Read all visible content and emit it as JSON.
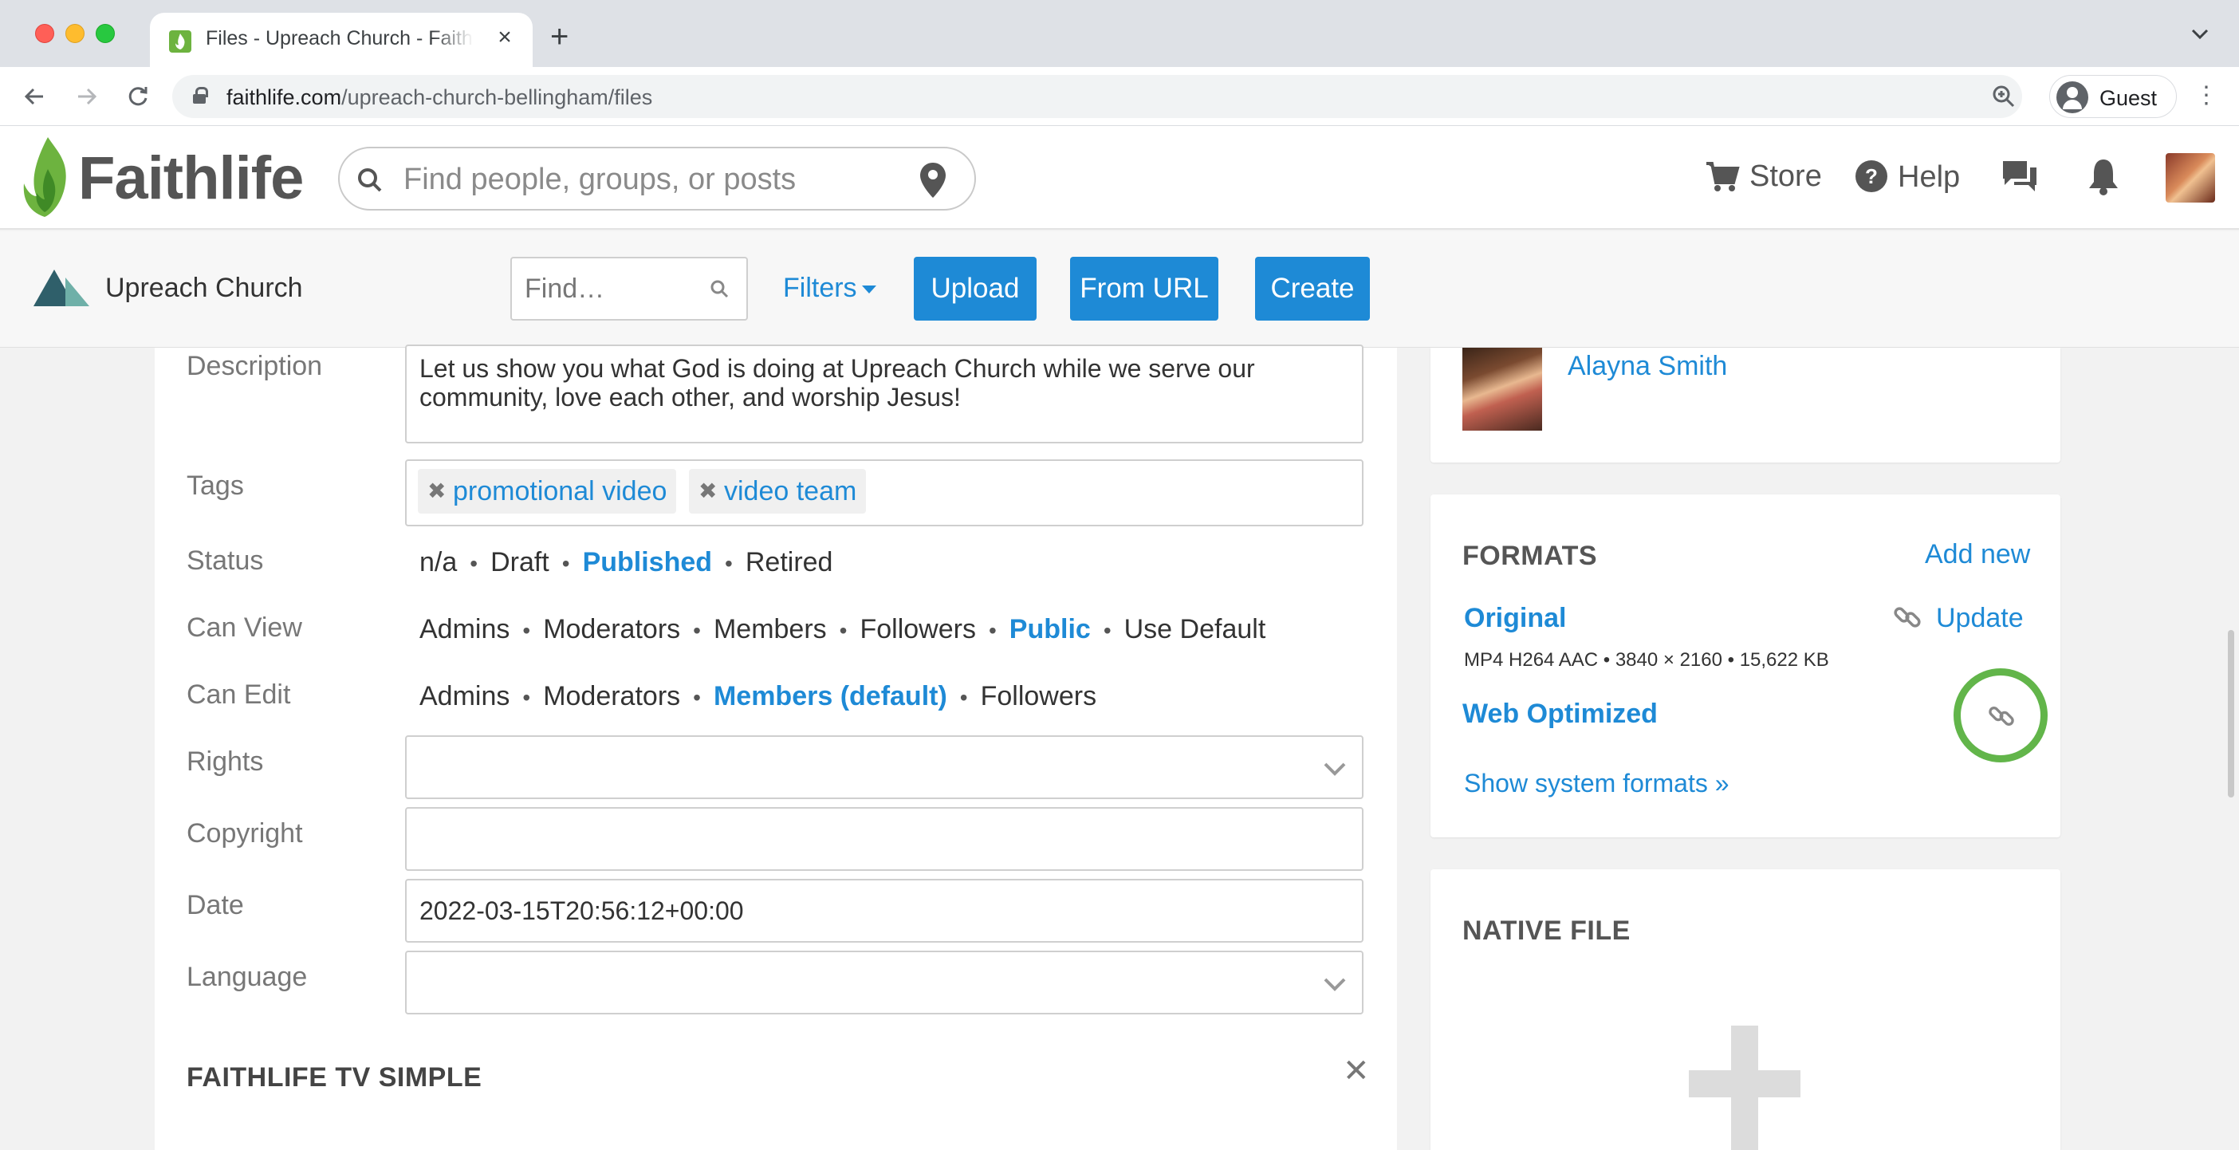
{
  "browser": {
    "tab_title": "Files - Upreach Church - Faithlife",
    "url_domain": "faithlife.com",
    "url_path": "/upreach-church-bellingham/files",
    "profile_label": "Guest"
  },
  "header": {
    "logo_text": "Faithlife",
    "search_placeholder": "Find people, groups, or posts",
    "store_label": "Store",
    "help_label": "Help"
  },
  "group_bar": {
    "group_name": "Upreach Church",
    "find_placeholder": "Find…",
    "filters_label": "Filters",
    "upload_label": "Upload",
    "from_url_label": "From URL",
    "create_label": "Create"
  },
  "form": {
    "description_label": "Description",
    "description_value": "Let us show you what God is doing at Upreach Church while we serve our community, love each other, and worship Jesus!",
    "tags_label": "Tags",
    "tags": [
      "promotional video",
      "video team"
    ],
    "status_label": "Status",
    "status_options": [
      "n/a",
      "Draft",
      "Published",
      "Retired"
    ],
    "status_selected": "Published",
    "can_view_label": "Can View",
    "can_view_options": [
      "Admins",
      "Moderators",
      "Members",
      "Followers",
      "Public",
      "Use Default"
    ],
    "can_view_selected": "Public",
    "can_edit_label": "Can Edit",
    "can_edit_options": [
      "Admins",
      "Moderators",
      "Members (default)",
      "Followers"
    ],
    "can_edit_selected": "Members (default)",
    "rights_label": "Rights",
    "rights_value": "",
    "copyright_label": "Copyright",
    "copyright_value": "",
    "date_label": "Date",
    "date_value": "2022-03-15T20:56:12+00:00",
    "language_label": "Language",
    "language_value": "",
    "section_title": "FAITHLIFE TV SIMPLE",
    "separator": "•"
  },
  "sidebar": {
    "author_name": "Alayna Smith",
    "formats_title": "FORMATS",
    "add_new_label": "Add new",
    "original_label": "Original",
    "original_meta": "MP4 H264 AAC • 3840 × 2160 • 15,622 KB",
    "update_label": "Update",
    "web_optimized_label": "Web Optimized",
    "show_system_formats_label": "Show system formats »",
    "native_file_title": "NATIVE FILE"
  },
  "colors": {
    "link_blue": "#1e8ad6",
    "brand_green": "#6db33f",
    "highlight_ring": "#62b54a"
  }
}
